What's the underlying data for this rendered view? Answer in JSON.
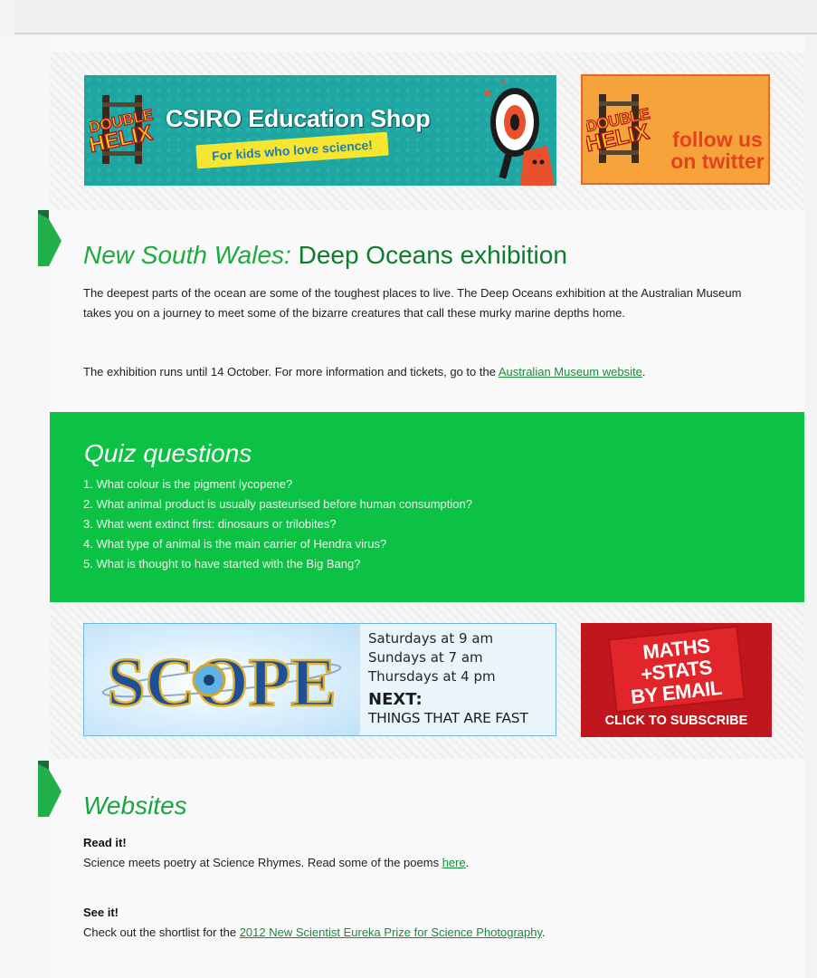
{
  "banners": {
    "csiro": {
      "logo_text": "DOUBLE HELIX",
      "title": "CSIRO Education Shop",
      "tagline": "For kids who love science!"
    },
    "twitter": {
      "logo_text": "DOUBLE HELIX",
      "line1": "follow us",
      "line2": "on twitter"
    },
    "scope": {
      "logo_text": "SCOPE",
      "times": [
        "Saturdays at 9 am",
        "Sundays at 7 am",
        "Thursdays at 4 pm"
      ],
      "next_label": "NEXT:",
      "next_topic": "THINGS THAT ARE FAST"
    },
    "maths": {
      "line1": "MATHS",
      "line2": "+STATS",
      "line3": "BY EMAIL",
      "cta": "CLICK TO SUBSCRIBE"
    }
  },
  "deep_oceans": {
    "title_prefix": "New South Wales:",
    "title": "Deep Oceans exhibition",
    "paragraph1": "The deepest parts of the ocean are some of the toughest places to live. The Deep Oceans exhibition at the Australian Museum takes you on a journey to meet some of the bizarre creatures that call these murky marine depths home.",
    "paragraph2_before_link": "The exhibition runs until 14 October. For more information and tickets, go to the ",
    "link_text": "Australian Museum website",
    "paragraph2_after_link": "."
  },
  "quiz": {
    "title": "Quiz questions",
    "questions": [
      "1. What colour is the pigment lycopene?",
      "2. What animal product is usually pasteurised before human consumption?",
      "3. What went extinct first: dinosaurs or trilobites?",
      "4. What type of animal is the main carrier of Hendra virus?",
      "5. What is thought to have started with the Big Bang?"
    ]
  },
  "websites": {
    "title": "Websites",
    "read_heading": "Read it!",
    "read_text": "Science meets poetry at Science Rhymes. Read some of the poems ",
    "read_link": "here",
    "read_after": ".",
    "see_heading": "See it!",
    "see_text": "Check out the shortlist for the ",
    "see_link": "2012 New Scientist Eureka Prize for Science Photography",
    "see_after": "."
  },
  "colors": {
    "accent_green": "#0bc245",
    "title_green": "#0c7d2e",
    "link_green": "#1b8a3c",
    "maths_red": "#c0171e",
    "twitter_orange": "#f7a33c",
    "csiro_teal": "#1fa6a2"
  }
}
